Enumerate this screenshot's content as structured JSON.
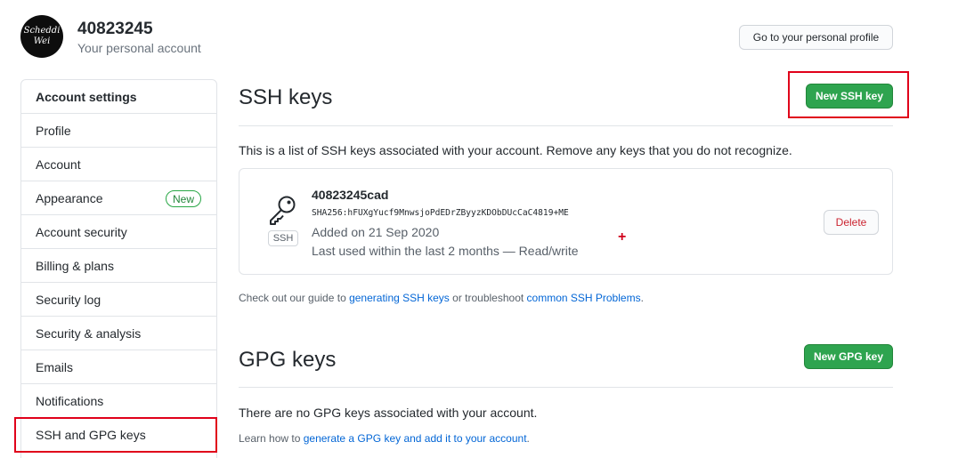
{
  "header": {
    "avatar_line1": "Scheddi",
    "avatar_line2": "Wei",
    "username": "40823245",
    "subtitle": "Your personal account",
    "profile_button": "Go to your personal profile"
  },
  "sidebar": {
    "heading": "Account settings",
    "items": [
      {
        "label": "Profile"
      },
      {
        "label": "Account"
      },
      {
        "label": "Appearance",
        "badge": "New"
      },
      {
        "label": "Account security"
      },
      {
        "label": "Billing & plans"
      },
      {
        "label": "Security log"
      },
      {
        "label": "Security & analysis"
      },
      {
        "label": "Emails"
      },
      {
        "label": "Notifications"
      },
      {
        "label": "SSH and GPG keys",
        "selected": true
      }
    ]
  },
  "ssh": {
    "title": "SSH keys",
    "new_button": "New SSH key",
    "description": "This is a list of SSH keys associated with your account. Remove any keys that you do not recognize.",
    "key": {
      "badge": "SSH",
      "name": "40823245cad",
      "fingerprint": "SHA256:hFUXgYucf9MnwsjoPdEDrZByyzKDObDUcCaC4819+ME",
      "added": "Added on 21 Sep 2020",
      "last_used": "Last used within the last 2 months — Read/write",
      "delete_button": "Delete"
    },
    "guide": {
      "prefix": "Check out our guide to ",
      "link1": "generating SSH keys",
      "middle": " or troubleshoot ",
      "link2": "common SSH Problems",
      "suffix": "."
    }
  },
  "gpg": {
    "title": "GPG keys",
    "new_button": "New GPG key",
    "empty_text": "There are no GPG keys associated with your account.",
    "learn": {
      "prefix": "Learn how to ",
      "link": "generate a GPG key and add it to your account",
      "suffix": "."
    }
  },
  "colors": {
    "primary_green": "#2ea44f",
    "link_blue": "#0366d6",
    "danger_red": "#cb2431",
    "highlight_red": "#e0001a"
  }
}
